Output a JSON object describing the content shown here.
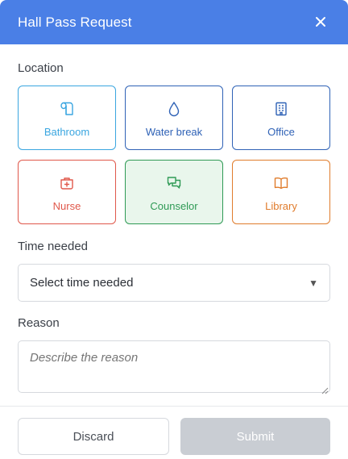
{
  "header": {
    "title": "Hall Pass Request",
    "close_icon": "close-icon"
  },
  "location": {
    "label": "Location",
    "options": [
      {
        "label": "Bathroom",
        "icon": "toilet-paper-icon",
        "color": "#3aa6e0",
        "bg": "#ffffff",
        "selected": false
      },
      {
        "label": "Water break",
        "icon": "water-drop-icon",
        "color": "#2f62b6",
        "bg": "#ffffff",
        "selected": false
      },
      {
        "label": "Office",
        "icon": "building-icon",
        "color": "#2f62b6",
        "bg": "#ffffff",
        "selected": false
      },
      {
        "label": "Nurse",
        "icon": "medical-kit-icon",
        "color": "#e0584b",
        "bg": "#ffffff",
        "selected": false
      },
      {
        "label": "Counselor",
        "icon": "chat-bubbles-icon",
        "color": "#2f9a55",
        "bg": "#e9f6ec",
        "selected": true
      },
      {
        "label": "Library",
        "icon": "open-book-icon",
        "color": "#e07c2c",
        "bg": "#ffffff",
        "selected": false
      }
    ]
  },
  "time": {
    "label": "Time needed",
    "value": "Select time needed"
  },
  "reason": {
    "label": "Reason",
    "placeholder": "Describe the reason"
  },
  "footer": {
    "discard_label": "Discard",
    "submit_label": "Submit"
  },
  "colors": {
    "header_bg": "#4a7fe6",
    "submit_disabled_bg": "#c9cdd3"
  }
}
